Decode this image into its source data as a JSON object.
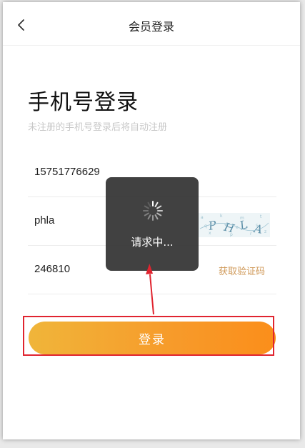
{
  "nav": {
    "title": "会员登录"
  },
  "login": {
    "heading": "手机号登录",
    "subtitle": "未注册的手机号登录后将自动注册",
    "phone_value": "15751776629",
    "captcha_value": "phla",
    "captcha_image_text": "PHLA",
    "sms_code_value": "246810",
    "get_code_label": "获取验证码",
    "submit_label": "登录"
  },
  "toast": {
    "text": "请求中..."
  },
  "colors": {
    "accent_gradient_start": "#f0b53a",
    "accent_gradient_end": "#fb8e1a",
    "link": "#d09a5a",
    "annotation": "#e0242f",
    "toast_bg": "#333333"
  },
  "icons": [
    "back-icon",
    "loading-spinner-icon",
    "captcha-image",
    "annotation-arrow"
  ]
}
